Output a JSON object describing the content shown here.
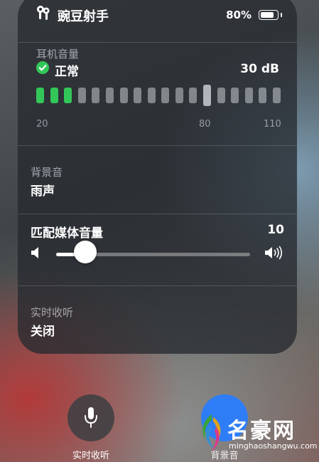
{
  "header": {
    "device_name": "豌豆射手",
    "battery_text": "80%",
    "battery_level": 0.8,
    "device_icon": "airpods-icon",
    "battery_icon": "battery-icon"
  },
  "headphone_level": {
    "label": "耳机音量",
    "status": "正常",
    "status_icon": "checkmark-circle-icon",
    "db_value": "30 dB",
    "scale_min": "20",
    "scale_mid": "80",
    "scale_max": "110",
    "bar_count": 18,
    "active_bars": 3,
    "marker_index": 12,
    "active_color": "#33c759"
  },
  "background_sounds": {
    "label": "背景音",
    "value": "雨声"
  },
  "media_volume": {
    "label": "匹配媒体音量",
    "value": "10",
    "level": 0.15,
    "low_icon": "speaker-low-icon",
    "high_icon": "speaker-high-icon"
  },
  "live_listen": {
    "label": "实时收听",
    "value": "关闭"
  },
  "bottom_buttons": {
    "live_listen_label": "实时收听",
    "live_listen_icon": "microphone-icon",
    "second_label": "背景音",
    "second_color": "#2f7df6"
  },
  "watermark": {
    "title": "名豪网",
    "subtitle": "minghaoshangwu.com"
  }
}
